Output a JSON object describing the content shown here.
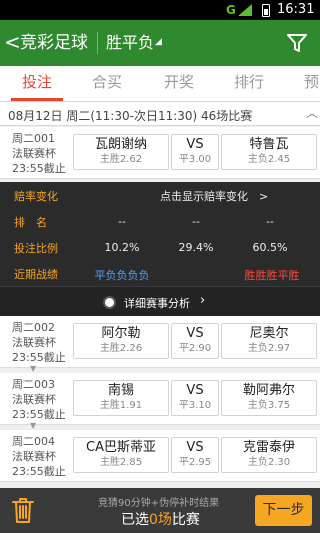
{
  "status": {
    "network": "G",
    "time": "16:31"
  },
  "header": {
    "back_symbol": "<",
    "title": "竞彩足球",
    "mode": "胜平负",
    "mode_caret": "◢"
  },
  "tabs": [
    {
      "label": "投注",
      "active": true
    },
    {
      "label": "合买",
      "active": false
    },
    {
      "label": "开奖",
      "active": false
    },
    {
      "label": "排行",
      "active": false
    },
    {
      "label": "预",
      "active": false
    }
  ],
  "date_bar": {
    "text": "08月12日 周二(11:30-次日11:30)  46场比赛"
  },
  "matches": [
    {
      "num": "周二001",
      "league": "法联赛杯",
      "deadline": "23:55截止",
      "home": "瓦朗谢纳",
      "home_odds": "主胜2.62",
      "vs": "VS",
      "draw_odds": "平3.00",
      "away": "特鲁瓦",
      "away_odds": "主负2.45"
    },
    {
      "num": "周二002",
      "league": "法联赛杯",
      "deadline": "23:55截止",
      "home": "阿尔勒",
      "home_odds": "主胜2.26",
      "vs": "VS",
      "draw_odds": "平2.90",
      "away": "尼奥尔",
      "away_odds": "主负2.97"
    },
    {
      "num": "周二003",
      "league": "法联赛杯",
      "deadline": "23:55截止",
      "home": "南锡",
      "home_odds": "主胜1.91",
      "vs": "VS",
      "draw_odds": "平3.10",
      "away": "勒阿弗尔",
      "away_odds": "主负3.75"
    },
    {
      "num": "周二004",
      "league": "法联赛杯",
      "deadline": "23:55截止",
      "home": "CA巴斯蒂亚",
      "home_odds": "主胜2.85",
      "vs": "VS",
      "draw_odds": "平2.95",
      "away": "克雷泰伊",
      "away_odds": "主负2.30"
    }
  ],
  "panel": {
    "odds_change_label": "赔率变化",
    "odds_change_action": "点击显示赔率变化",
    "ranking_label": "排　名",
    "ranking_values": [
      "--",
      "--",
      "--"
    ],
    "bet_ratio_label": "投注比例",
    "bet_ratio_values": [
      "10.2%",
      "29.4%",
      "60.5%"
    ],
    "form_label": "近期战绩",
    "form_home": "平负负负负",
    "form_away": "胜胜胜平胜",
    "detail_label": "详细赛事分析"
  },
  "bottom": {
    "hint": "竞猜90分钟+伪停补时结果",
    "selected_prefix": "已选",
    "selected_count": "0场",
    "selected_suffix": "比赛",
    "next_label": "下一步"
  },
  "colors": {
    "header_green": "#2f8a2f",
    "accent_red": "#e9472c",
    "accent_orange": "#f5a623"
  }
}
